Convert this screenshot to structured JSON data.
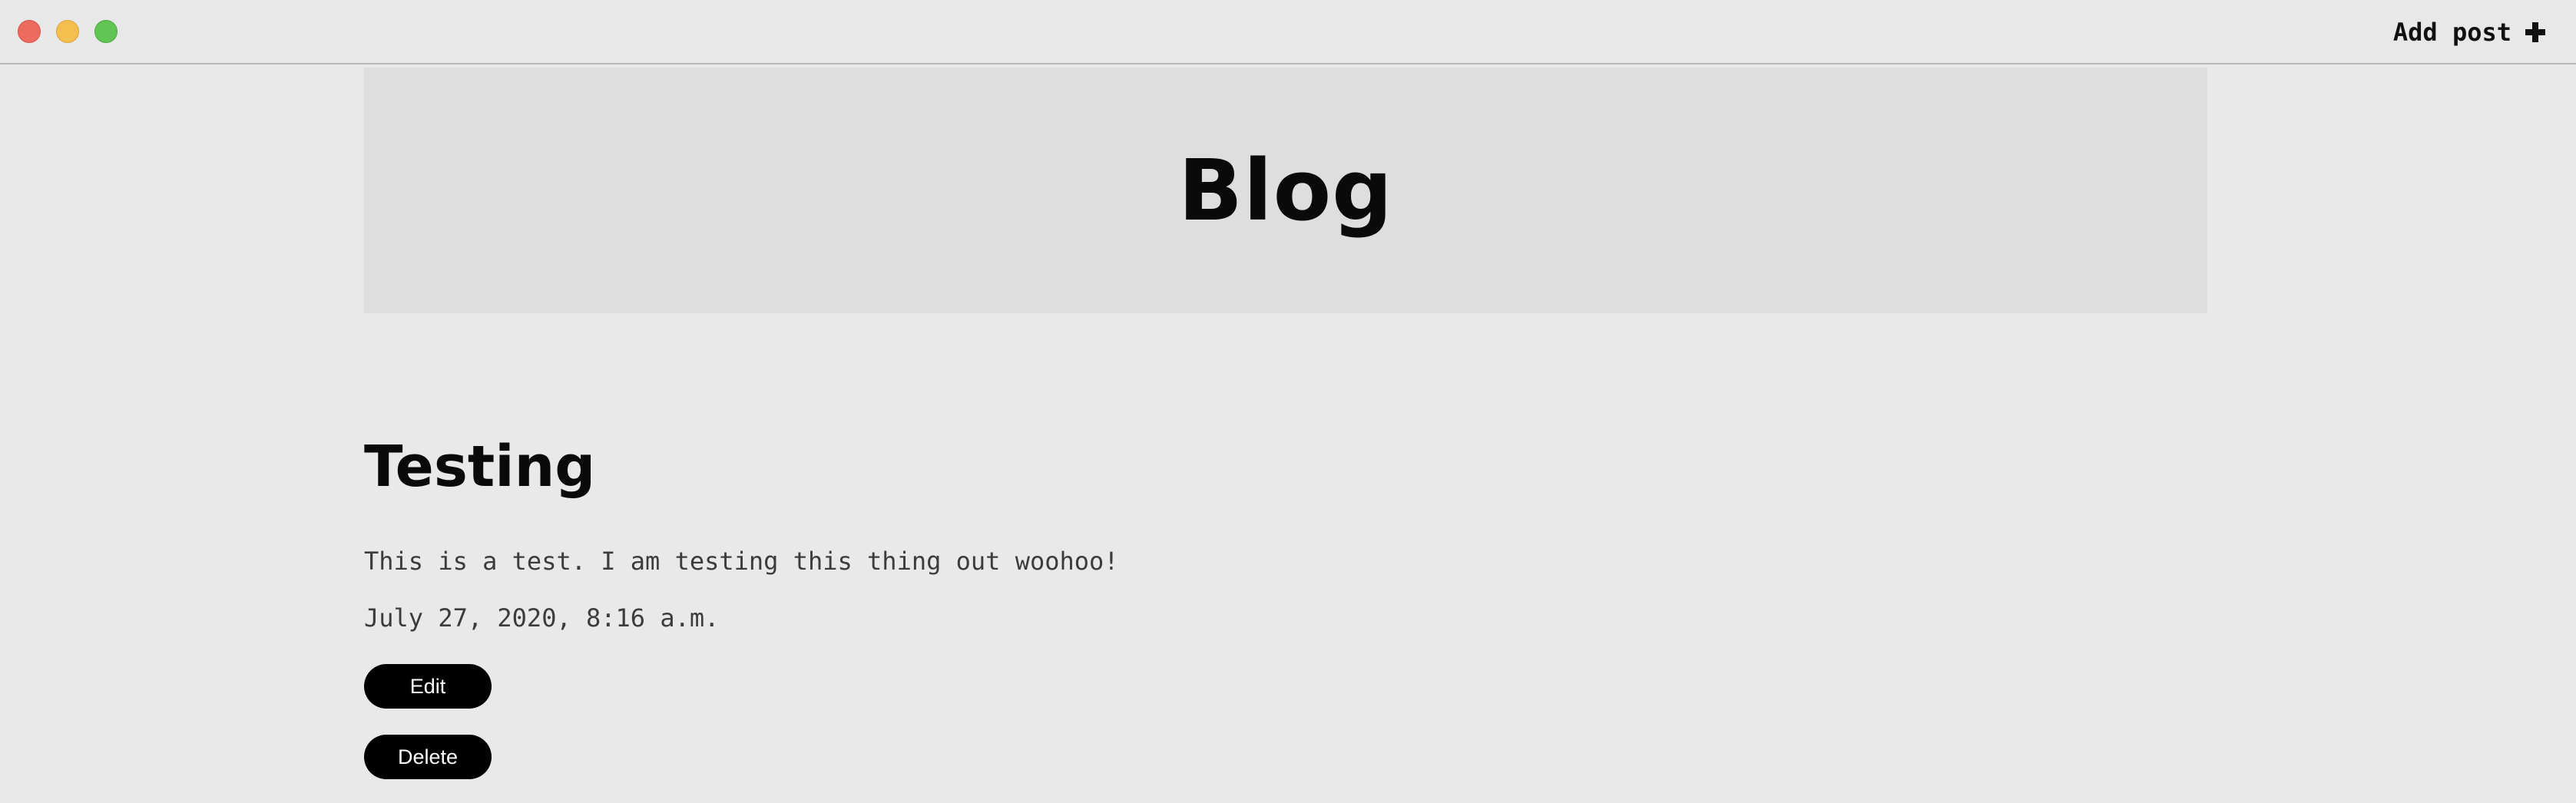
{
  "window": {
    "controls": [
      "close",
      "minimize",
      "zoom"
    ]
  },
  "nav": {
    "add_post_label": "Add post",
    "add_icon": "plus-icon"
  },
  "hero": {
    "title": "Blog"
  },
  "post": {
    "title": "Testing",
    "body": "This is a test. I am testing this thing out woohoo!",
    "date": "July 27, 2020, 8:16 a.m.",
    "edit_label": "Edit",
    "delete_label": "Delete"
  },
  "colors": {
    "background": "#e9e9e9",
    "hero_background": "#dedede",
    "button_background": "#000000",
    "button_text": "#ffffff",
    "close": "#ed6a5e",
    "minimize": "#f5bf4f",
    "zoom": "#61c554"
  }
}
